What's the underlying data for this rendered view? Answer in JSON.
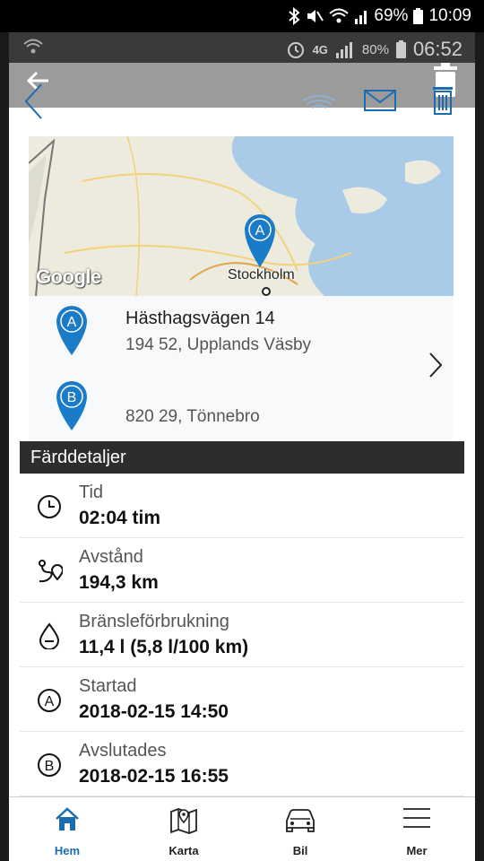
{
  "outer_status": {
    "battery": "69%",
    "time": "10:09"
  },
  "inner_status": {
    "network": "4G",
    "battery": "80%",
    "time": "06:52"
  },
  "map": {
    "city_label": "Stockholm",
    "watermark": "Google",
    "pin_label": "A"
  },
  "route": {
    "start": {
      "pin": "A",
      "street": "Hästhagsvägen 14",
      "city": "194 52, Upplands Väsby"
    },
    "end": {
      "pin": "B",
      "street": "",
      "city": "820 29, Tönnebro"
    }
  },
  "section_title": "Färddetaljer",
  "details": [
    {
      "label": "Tid",
      "value": "02:04 tim",
      "icon": "clock-icon"
    },
    {
      "label": "Avstånd",
      "value": "194,3 km",
      "icon": "route-icon"
    },
    {
      "label": "Bränsleförbrukning",
      "value": "11,4 l (5,8 l/100 km)",
      "icon": "fuel-drop-icon"
    },
    {
      "label": "Startad",
      "value": "2018-02-15 14:50",
      "icon": "start-a-icon"
    },
    {
      "label": "Avslutades",
      "value": "2018-02-15 16:55",
      "icon": "end-b-icon"
    }
  ],
  "nav": [
    {
      "label": "Hem",
      "icon": "home-icon",
      "active": true
    },
    {
      "label": "Karta",
      "icon": "map-icon"
    },
    {
      "label": "Bil",
      "icon": "car-icon"
    },
    {
      "label": "Mer",
      "icon": "menu-icon"
    }
  ],
  "colors": {
    "accent": "#1b6bb3",
    "pin": "#1a7bc8",
    "header": "#2d2d2d"
  }
}
